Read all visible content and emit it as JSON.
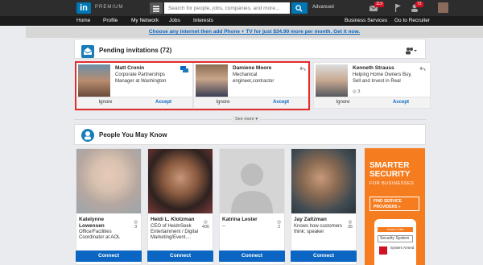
{
  "topbar": {
    "logo": "in",
    "premium": "PREMIUM",
    "search_placeholder": "Search for people, jobs, companies, and more...",
    "advanced": "Advanced",
    "badge_messages": "119",
    "badge_notifications": "72"
  },
  "nav": {
    "items": [
      "Home",
      "Profile",
      "My Network",
      "Jobs",
      "Interests"
    ],
    "right_items": [
      "Business Services",
      "Go to Recruiter"
    ]
  },
  "promo": {
    "text": "Choose any internet then add Phone + TV for just $34.90 more per month. Get it now."
  },
  "invitations": {
    "title": "Pending invitations (72)",
    "cards": [
      {
        "name": "Matt Cronin",
        "title": "Corporate Partnerships Manager at Washington",
        "connections": "",
        "ignore": "Ignore",
        "accept": "Accept"
      },
      {
        "name": "Damiene Moore",
        "title": "Mechanical engineer,contractor",
        "connections": "",
        "ignore": "Ignore",
        "accept": "Accept"
      },
      {
        "name": "Kenneth Strauss",
        "title": "Helping Home Owners Buy, Sell and Invest in Real",
        "connections": "3",
        "ignore": "Ignore",
        "accept": "Accept"
      }
    ],
    "see_more": "See more"
  },
  "pymk": {
    "title": "People You May Know",
    "people": [
      {
        "name": "Katelynne Lowensen",
        "title": "Office/Facilities Coordinator at AOL",
        "count": "3",
        "connect": "Connect"
      },
      {
        "name": "Heidi L. Klotzman",
        "title": "CEO of HeidnSeek Entertainment / Digital Marketing/Event....",
        "count": "406",
        "connect": "Connect"
      },
      {
        "name": "Katrina Lester",
        "title": "--",
        "count": "2",
        "connect": "Connect"
      },
      {
        "name": "Jay Zaltzman",
        "title": "Knows how customers think; speaker",
        "count": "35",
        "connect": "Connect"
      }
    ]
  },
  "ad": {
    "headline_1": "SMARTER",
    "headline_2": "SECURITY",
    "sub": "FOR BUSINESSES",
    "cta": "FIND SERVICE PROVIDERS »",
    "phone_bar": "John's Cafe",
    "phone_field": "Security System",
    "phone_status": "System Armed"
  },
  "colors": {
    "brand": "#0077b5",
    "accept": "#0a66c2",
    "highlight": "#e52b2b",
    "ad": "#f57c1f"
  }
}
